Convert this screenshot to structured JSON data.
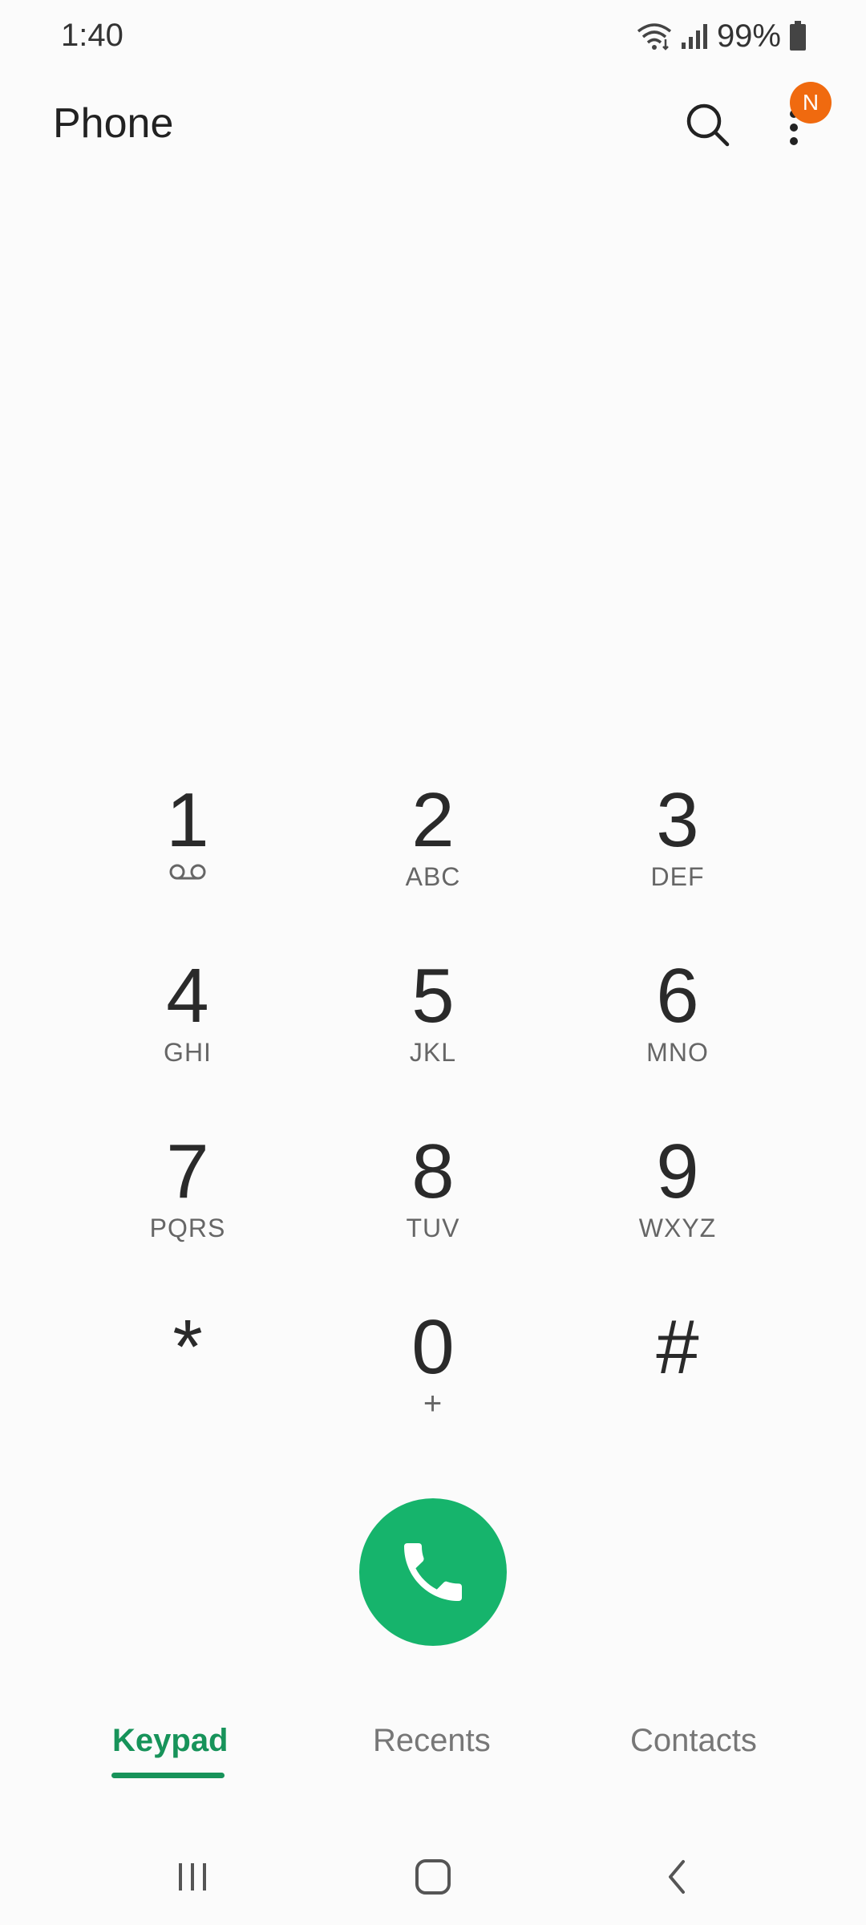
{
  "status_bar": {
    "time": "1:40",
    "battery": "99%"
  },
  "app_bar": {
    "title": "Phone",
    "badge": "N"
  },
  "keypad": [
    {
      "digit": "1",
      "letters": "",
      "sub_icon": "voicemail-icon"
    },
    {
      "digit": "2",
      "letters": "ABC"
    },
    {
      "digit": "3",
      "letters": "DEF"
    },
    {
      "digit": "4",
      "letters": "GHI"
    },
    {
      "digit": "5",
      "letters": "JKL"
    },
    {
      "digit": "6",
      "letters": "MNO"
    },
    {
      "digit": "7",
      "letters": "PQRS"
    },
    {
      "digit": "8",
      "letters": "TUV"
    },
    {
      "digit": "9",
      "letters": "WXYZ"
    },
    {
      "digit": "*",
      "letters": ""
    },
    {
      "digit": "0",
      "letters": "+"
    },
    {
      "digit": "#",
      "letters": ""
    }
  ],
  "tabs": [
    {
      "label": "Keypad",
      "active": true
    },
    {
      "label": "Recents",
      "active": false
    },
    {
      "label": "Contacts",
      "active": false
    }
  ],
  "colors": {
    "accent": "#17935a",
    "call": "#16b46c",
    "badge": "#f06a0f"
  }
}
